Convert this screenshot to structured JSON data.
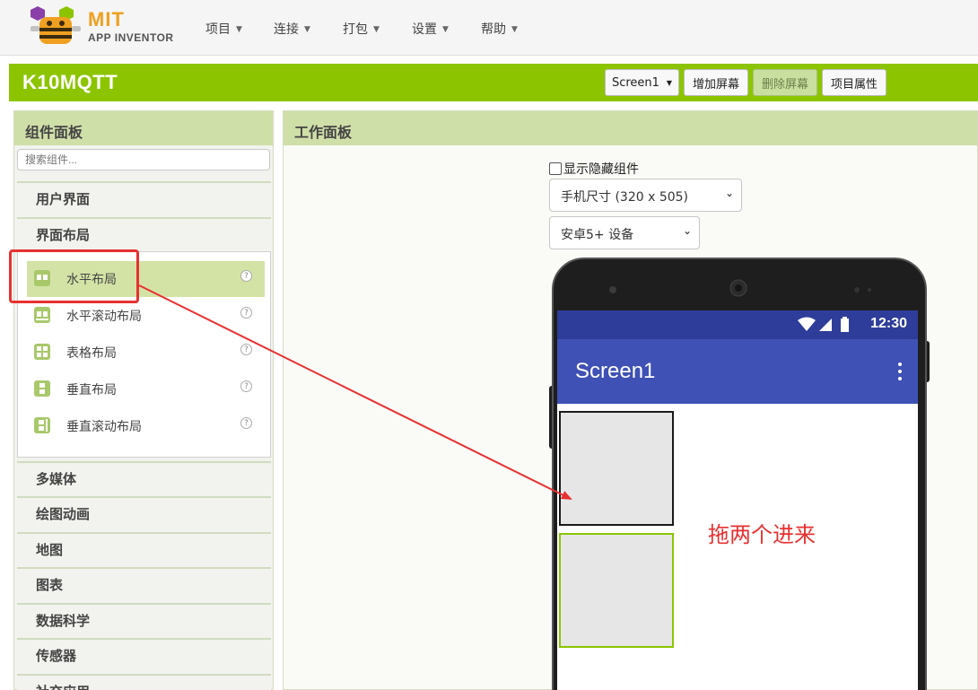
{
  "brand": {
    "title": "MIT",
    "subtitle": "APP INVENTOR"
  },
  "menu": [
    "项目",
    "连接",
    "打包",
    "设置",
    "帮助"
  ],
  "project": {
    "name": "K10MQTT",
    "screen_select": "Screen1",
    "add_screen": "增加屏幕",
    "remove_screen": "删除屏幕",
    "project_properties": "项目属性"
  },
  "palette": {
    "title": "组件面板",
    "search_placeholder": "搜索组件...",
    "categories_top": [
      "用户界面",
      "界面布局"
    ],
    "layout_components": [
      {
        "label": "水平布局",
        "icon": "horizontal-arrangement-icon",
        "selected": true
      },
      {
        "label": "水平滚动布局",
        "icon": "horizontal-scroll-arrangement-icon",
        "selected": false
      },
      {
        "label": "表格布局",
        "icon": "table-arrangement-icon",
        "selected": false
      },
      {
        "label": "垂直布局",
        "icon": "vertical-arrangement-icon",
        "selected": false
      },
      {
        "label": "垂直滚动布局",
        "icon": "vertical-scroll-arrangement-icon",
        "selected": false
      }
    ],
    "help_glyph": "?",
    "categories_bottom": [
      "多媒体",
      "绘图动画",
      "地图",
      "图表",
      "数据科学",
      "传感器",
      "社交应用"
    ]
  },
  "viewer": {
    "title": "工作面板",
    "show_hidden": "显示隐藏组件",
    "show_hidden_checked": false,
    "size_select": "手机尺寸 (320 x 505)",
    "theme_select": "安卓5+ 设备"
  },
  "phone": {
    "time": "12:30",
    "screen_title": "Screen1"
  },
  "annotation": "拖两个进来",
  "colors": {
    "project_bar": "#8cc500",
    "panel_header": "#cfdfa8",
    "app_bar": "#3f51b5",
    "status_bar": "#2f3d9a",
    "annotation": "#e83030"
  }
}
